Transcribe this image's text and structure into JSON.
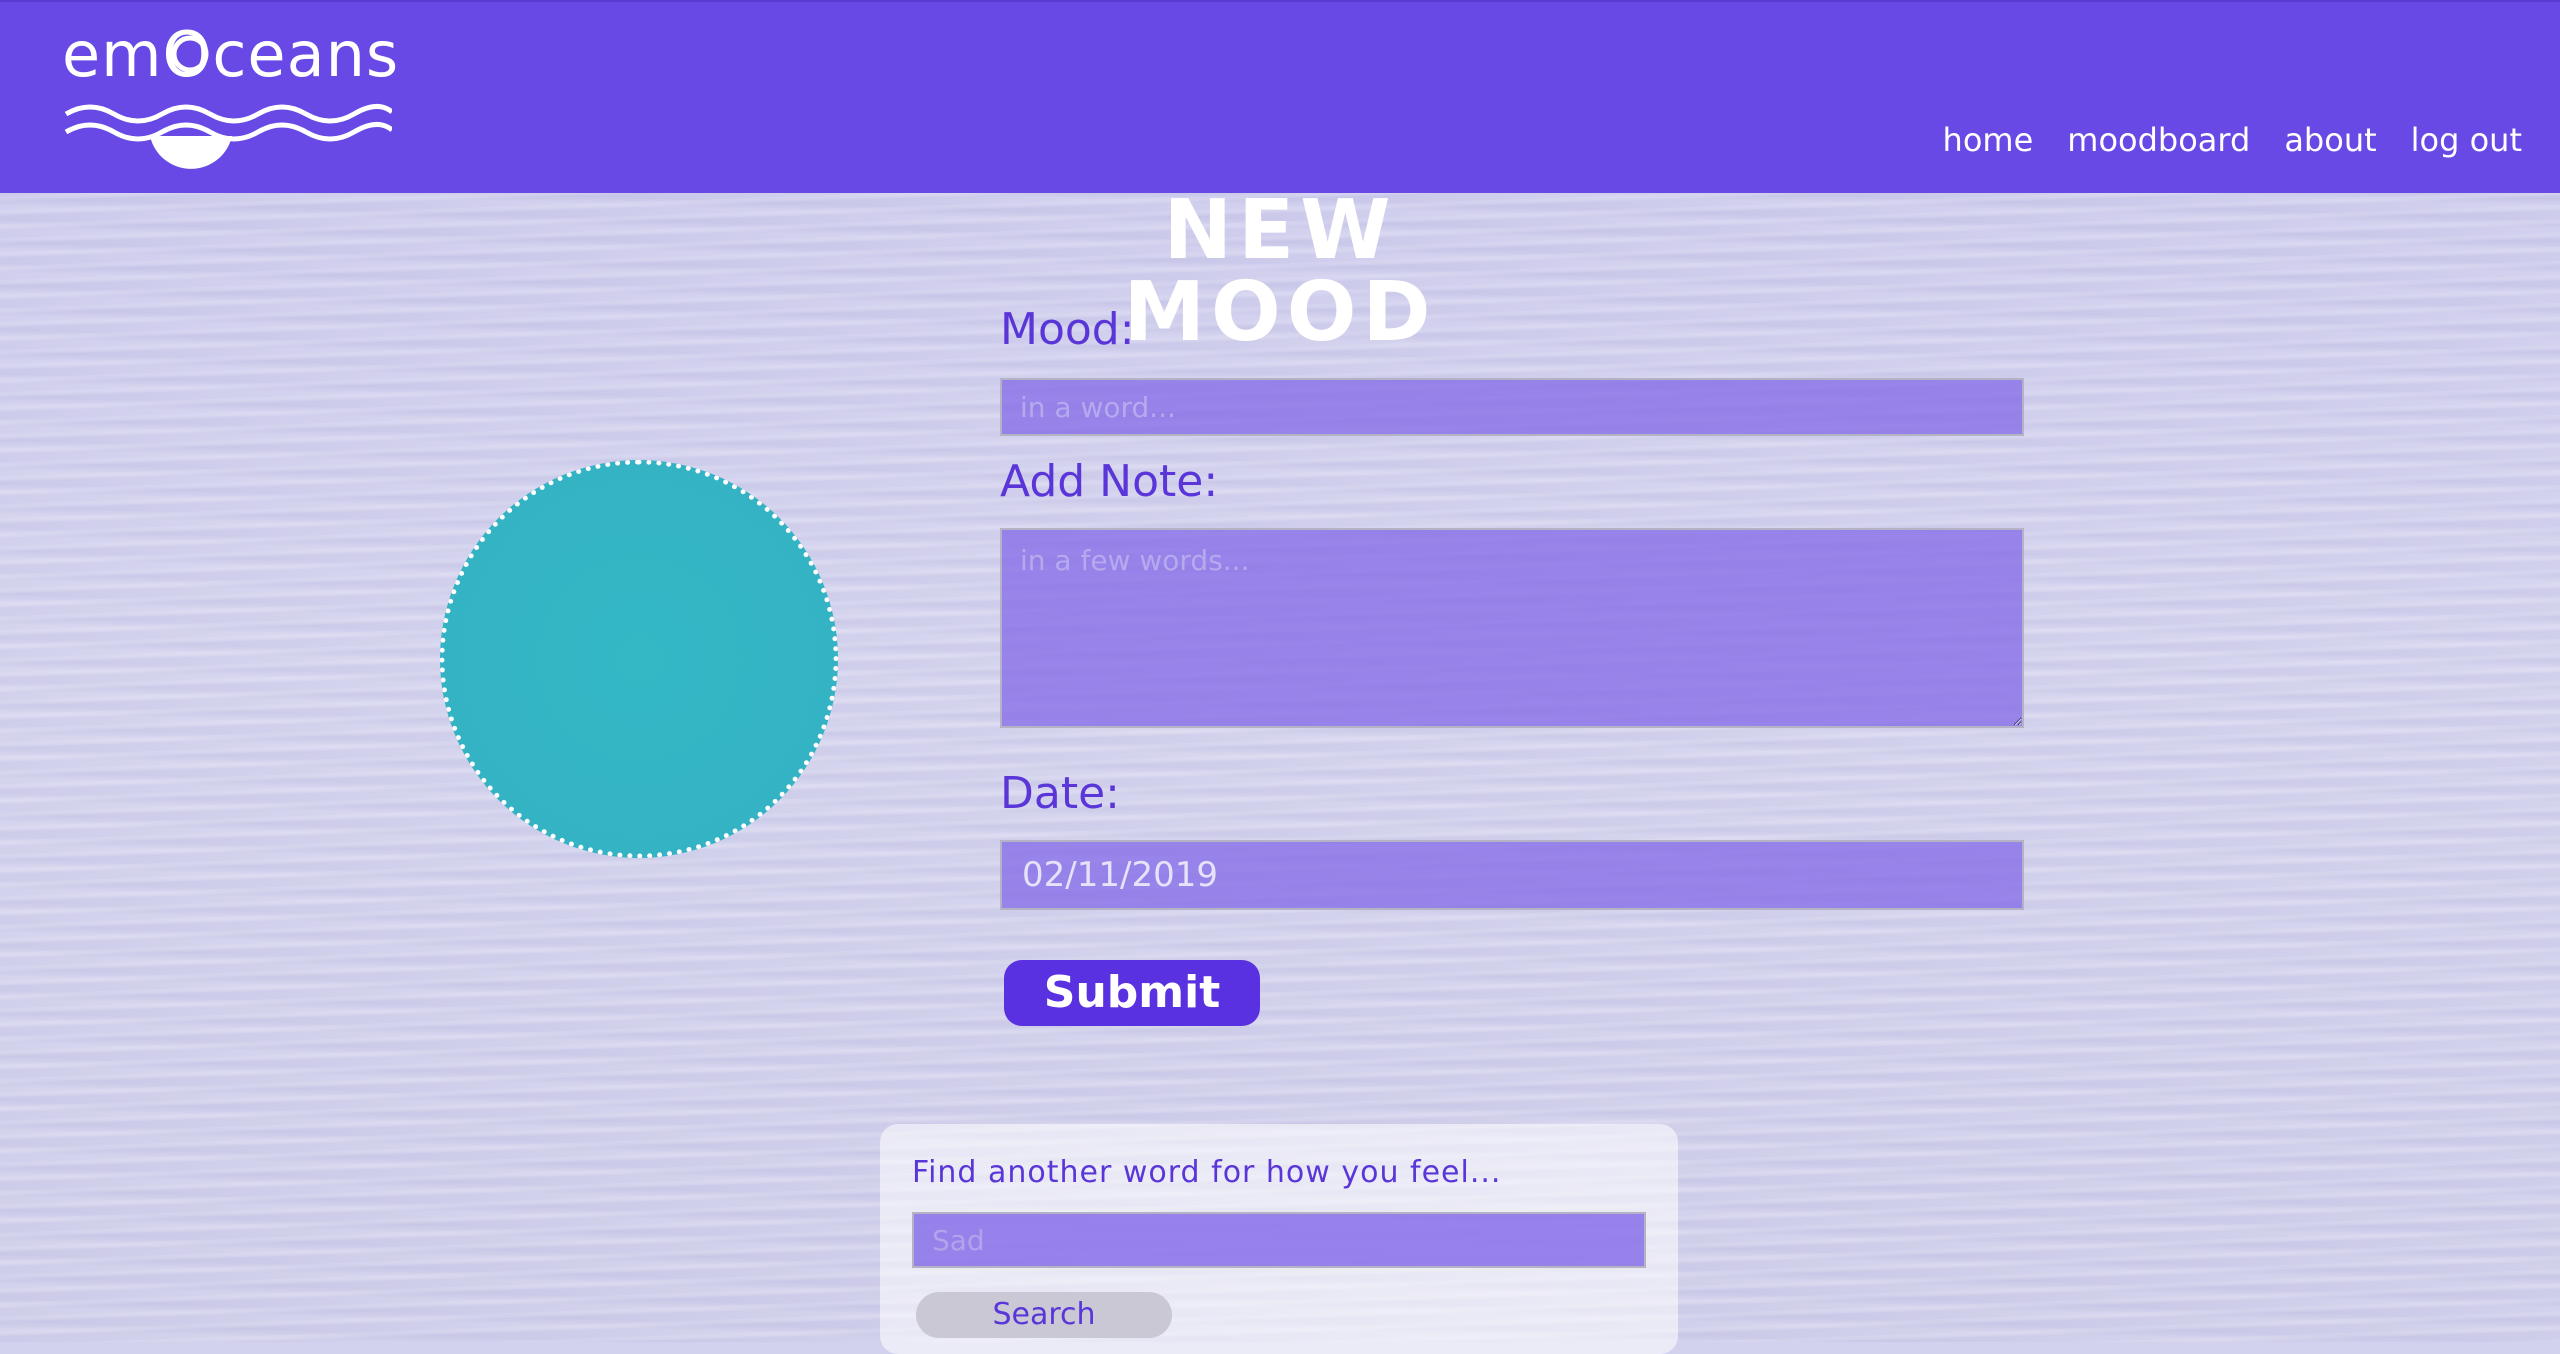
{
  "header": {
    "logo_text": "emOceans",
    "nav": [
      {
        "label": "home"
      },
      {
        "label": "moodboard"
      },
      {
        "label": "about"
      },
      {
        "label": "log out"
      }
    ]
  },
  "page": {
    "title": "NEW MOOD"
  },
  "mood_circle": {
    "color": "#34b4c5"
  },
  "form": {
    "mood_label": "Mood:",
    "mood_placeholder": "in a word...",
    "note_label": "Add Note:",
    "note_placeholder": "in a few words...",
    "date_label": "Date:",
    "date_value": "02/11/2019",
    "submit_label": "Submit"
  },
  "search": {
    "prompt": "Find another word for how you feel...",
    "placeholder": "Sad",
    "button_label": "Search"
  },
  "colors": {
    "header": "#6849e6",
    "accent": "#5a31e0",
    "field": "#7f64e8"
  }
}
